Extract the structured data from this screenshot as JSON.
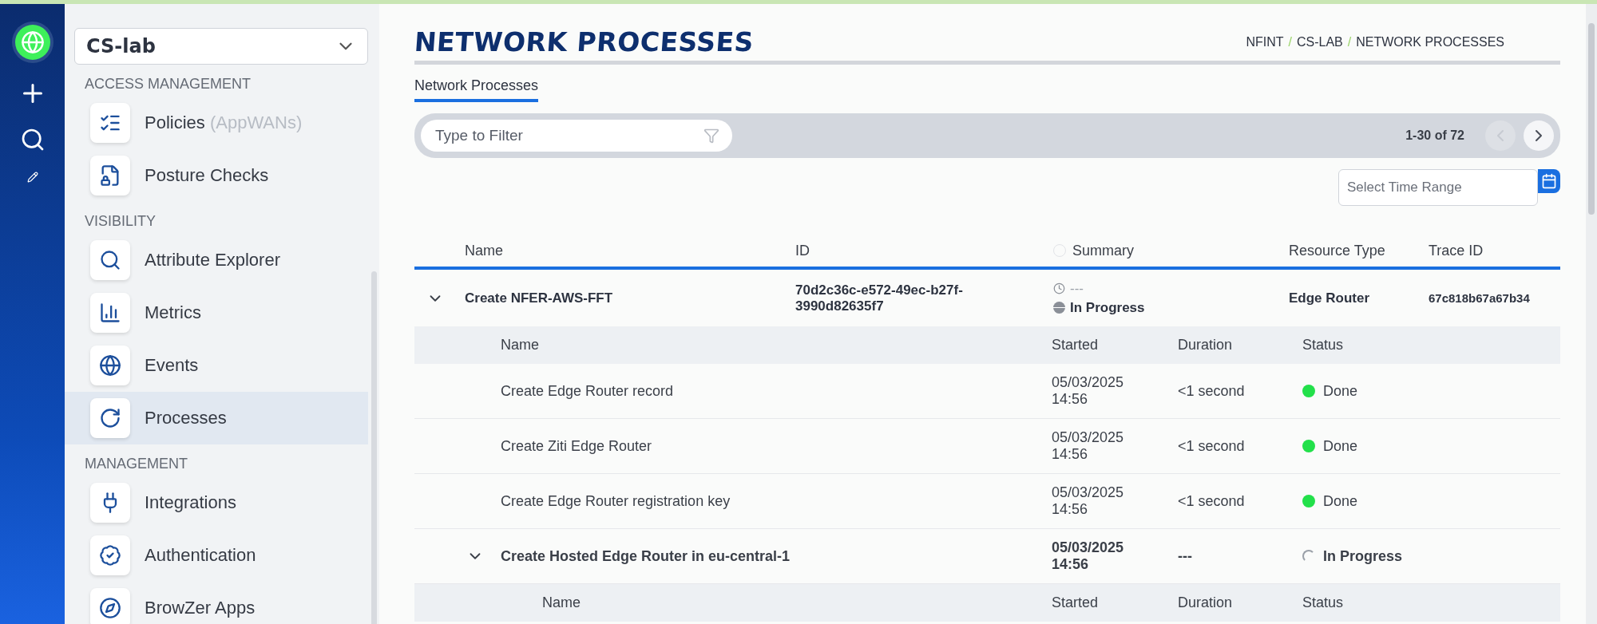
{
  "sidebar": {
    "network": "CS-lab",
    "sections": [
      {
        "title": "ACCESS MANAGEMENT",
        "items": [
          {
            "label": "Policies",
            "note": "(AppWANs)",
            "selected": false
          },
          {
            "label": "Posture Checks",
            "selected": false
          }
        ]
      },
      {
        "title": "VISIBILITY",
        "items": [
          {
            "label": "Attribute Explorer",
            "selected": false
          },
          {
            "label": "Metrics",
            "selected": false
          },
          {
            "label": "Events",
            "selected": false
          },
          {
            "label": "Processes",
            "selected": true
          }
        ]
      },
      {
        "title": "MANAGEMENT",
        "items": [
          {
            "label": "Integrations",
            "selected": false
          },
          {
            "label": "Authentication",
            "selected": false
          },
          {
            "label": "BrowZer Apps",
            "selected": false
          }
        ]
      }
    ]
  },
  "page": {
    "title": "NETWORK PROCESSES",
    "breadcrumb": [
      {
        "kind": "link",
        "text": "NFINT"
      },
      {
        "kind": "separator",
        "text": "/"
      },
      {
        "kind": "link",
        "text": "CS-LAB"
      },
      {
        "kind": "separator",
        "text": "/"
      },
      {
        "kind": "link",
        "text": "NETWORK PROCESSES"
      }
    ],
    "tabs": [
      {
        "label": "Network Processes",
        "selected": true
      }
    ],
    "filter": {
      "placeholder": "Type to Filter"
    },
    "pagination": {
      "label": "1-30 of 72",
      "prev_disabled": true
    },
    "time_range": {
      "placeholder": "Select Time Range"
    }
  },
  "table": {
    "columns": [
      "Name",
      "ID",
      "Summary",
      "Resource Type",
      "Trace ID"
    ],
    "rows": [
      {
        "expanded": true,
        "name": "Create NFER-AWS-FFT",
        "id": "70d2c36c-e572-49ec-b27f-3990d82635f7",
        "summary_time": "---",
        "summary_status": "In Progress",
        "resource_type": "Edge Router",
        "trace_id": "67c818b67a67b34",
        "steps": {
          "columns": [
            "Name",
            "Started",
            "Duration",
            "Status"
          ],
          "rows": [
            {
              "kind": "step",
              "name": "Create Edge Router record",
              "started": "05/03/2025 14:56",
              "duration": "<1 second",
              "done": true,
              "status": "Done"
            },
            {
              "kind": "step",
              "name": "Create Ziti Edge Router",
              "started": "05/03/2025 14:56",
              "duration": "<1 second",
              "done": true,
              "status": "Done"
            },
            {
              "kind": "step",
              "name": "Create Edge Router registration key",
              "started": "05/03/2025 14:56",
              "duration": "<1 second",
              "done": true,
              "status": "Done"
            },
            {
              "kind": "group",
              "expanded": true,
              "name": "Create Hosted Edge Router in eu-central-1",
              "started": "05/03/2025 14:56",
              "duration": "---",
              "done": false,
              "status": "In Progress",
              "steps": {
                "columns": [
                  "Name",
                  "Started",
                  "Duration",
                  "Status"
                ]
              }
            }
          ]
        }
      }
    ]
  }
}
